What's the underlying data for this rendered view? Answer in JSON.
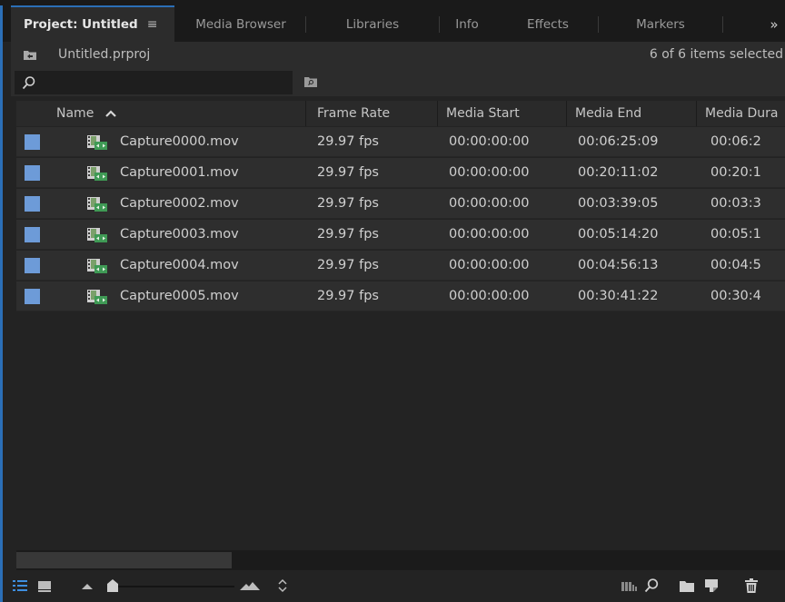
{
  "tabs": [
    {
      "label": "Project: Untitled",
      "menu_glyph": "≡",
      "active": true
    },
    {
      "label": "Media Browser"
    },
    {
      "label": "Libraries"
    },
    {
      "label": "Info"
    },
    {
      "label": "Effects"
    },
    {
      "label": "Markers"
    }
  ],
  "tab_overflow": "»",
  "project": {
    "name": "Untitled.prproj",
    "selection_status": "6 of 6 items selected"
  },
  "search": {
    "value": "",
    "placeholder": ""
  },
  "columns": {
    "name": "Name",
    "frame_rate": "Frame Rate",
    "media_start": "Media Start",
    "media_end": "Media End",
    "media_duration": "Media Dura"
  },
  "sort": {
    "column": "Name",
    "direction": "ascending"
  },
  "rows": [
    {
      "name": "Capture0000.mov",
      "frame_rate": "29.97 fps",
      "media_start": "00:00:00:00",
      "media_end": "00:06:25:09",
      "media_duration": "00:06:2"
    },
    {
      "name": "Capture0001.mov",
      "frame_rate": "29.97 fps",
      "media_start": "00:00:00:00",
      "media_end": "00:20:11:02",
      "media_duration": "00:20:1"
    },
    {
      "name": "Capture0002.mov",
      "frame_rate": "29.97 fps",
      "media_start": "00:00:00:00",
      "media_end": "00:03:39:05",
      "media_duration": "00:03:3"
    },
    {
      "name": "Capture0003.mov",
      "frame_rate": "29.97 fps",
      "media_start": "00:00:00:00",
      "media_end": "00:05:14:20",
      "media_duration": "00:05:1"
    },
    {
      "name": "Capture0004.mov",
      "frame_rate": "29.97 fps",
      "media_start": "00:00:00:00",
      "media_end": "00:04:56:13",
      "media_duration": "00:04:5"
    },
    {
      "name": "Capture0005.mov",
      "frame_rate": "29.97 fps",
      "media_start": "00:00:00:00",
      "media_end": "00:30:41:22",
      "media_duration": "00:30:4"
    }
  ],
  "label_color": "#6d9bd8",
  "accent_color": "#2b6fb7",
  "toolbar": {
    "icons": [
      "list-view-icon",
      "icon-view-icon",
      "zoom-out-icon",
      "zoom-slider",
      "zoom-in-icon",
      "sort-icons-icon",
      "automate-to-sequence-icon",
      "find-icon",
      "new-bin-icon",
      "new-item-icon",
      "clear-icon"
    ],
    "zoom_level": 0.0
  }
}
